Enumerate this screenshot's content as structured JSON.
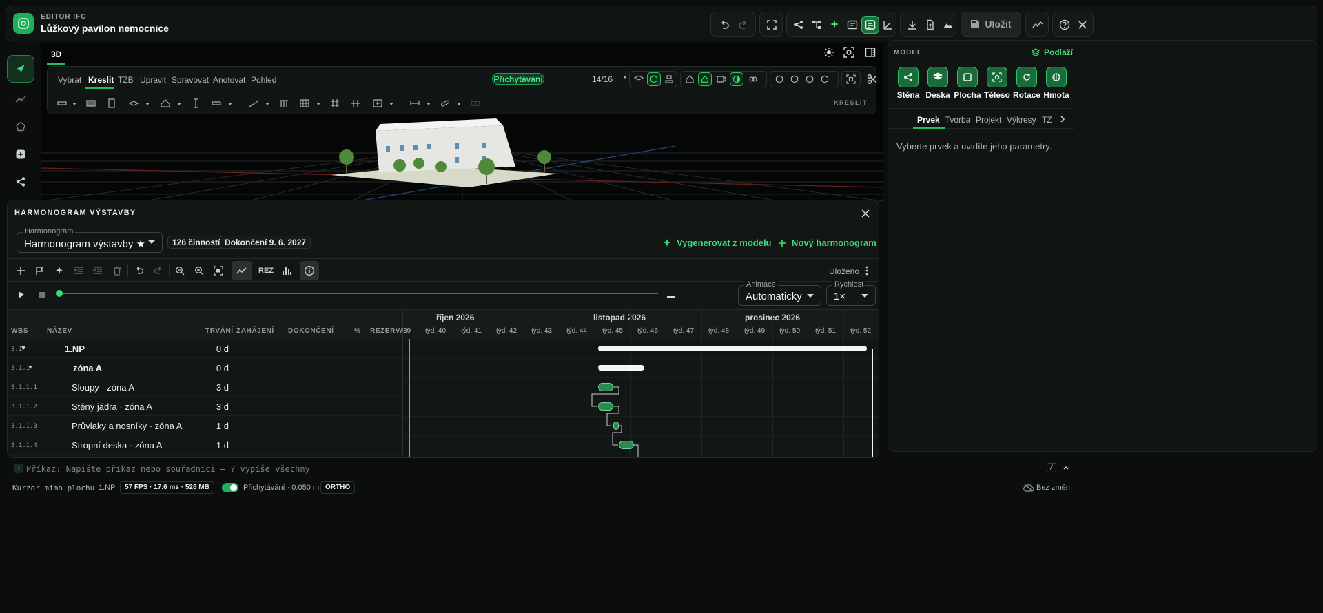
{
  "app": {
    "subtitle": "EDITOR IFC",
    "title": "Lůžkový pavilon nemocnice",
    "save_label": "Uložit"
  },
  "viewport": {
    "tab": "3D"
  },
  "ribbon": {
    "tabs": [
      "Vybrat",
      "Kreslit",
      "TZB",
      "Upravit",
      "Spravovat",
      "Anotovat",
      "Pohled"
    ],
    "active_tab": "Kreslit",
    "snap_label": "Přichytávání",
    "snap_count": "14/16",
    "section_label": "KRESLIT"
  },
  "right_panel": {
    "title": "MODEL",
    "floors_link": "Podlaží",
    "cards": [
      "Stěna",
      "Deska",
      "Plocha",
      "Těleso",
      "Rotace",
      "Hmota"
    ],
    "tabs": [
      "Prvek",
      "Tvorba",
      "Projekt",
      "Výkresy",
      "TZB"
    ],
    "hint": "Vyberte prvek a uvidíte jeho parametry."
  },
  "schedule": {
    "title": "HARMONOGRAM VÝSTAVBY",
    "select_label": "Harmonogram",
    "select_value": "Harmonogram výstavby ★",
    "activities": "126 činností",
    "completion": "Dokončení 9. 6. 2027",
    "generate_link": "Vygenerovat z modelu",
    "new_link": "Nový harmonogram",
    "rez_label": "REZ",
    "saved": "Uloženo",
    "animation_label": "Animace",
    "animation_value": "Automaticky",
    "speed_label": "Rychlost",
    "speed_value": "1×",
    "columns": [
      "WBS",
      "NÁZEV",
      "TRVÁNÍ",
      "ZAHÁJENÍ",
      "DOKONČENÍ",
      "%",
      "REZERVA"
    ],
    "months": [
      "říjen 2026",
      "listopad 2026",
      "prosinec 2026"
    ],
    "weeks": [
      "39",
      "týd. 40",
      "týd. 41",
      "týd. 42",
      "týd. 43",
      "týd. 44",
      "týd. 45",
      "týd. 46",
      "týd. 47",
      "týd. 48",
      "týd. 49",
      "týd. 50",
      "týd. 51",
      "týd. 52"
    ],
    "rows": [
      {
        "wbs": "3.1",
        "name": "1.NP",
        "duration": "0 d"
      },
      {
        "wbs": "3.1.1",
        "name": "zóna A",
        "duration": "0 d"
      },
      {
        "wbs": "3.1.1.1",
        "name": "Sloupy · zóna A",
        "duration": "3 d"
      },
      {
        "wbs": "3.1.1.2",
        "name": "Stěny jádra · zóna A",
        "duration": "3 d"
      },
      {
        "wbs": "3.1.1.3",
        "name": "Průvlaky a nosníky · zóna A",
        "duration": "1 d"
      },
      {
        "wbs": "3.1.1.4",
        "name": "Stropní deska · zóna A",
        "duration": "1 d"
      }
    ]
  },
  "command": {
    "placeholder": "Příkaz: Napište příkaz nebo souřadnici — ? vypíše všechny"
  },
  "status": {
    "cursor": "Kurzor mimo plochu",
    "floor": "1.NP",
    "perf": "57 FPS · 17.6 ms · 528 MB",
    "snap": "Přichytávání · 0.050 m",
    "ortho": "ORTHO",
    "changes": "Bez změn"
  },
  "colors": {
    "accent": "#1fae5c",
    "today_line": "#d98a1a",
    "task_bar": "#2b8a4f"
  }
}
